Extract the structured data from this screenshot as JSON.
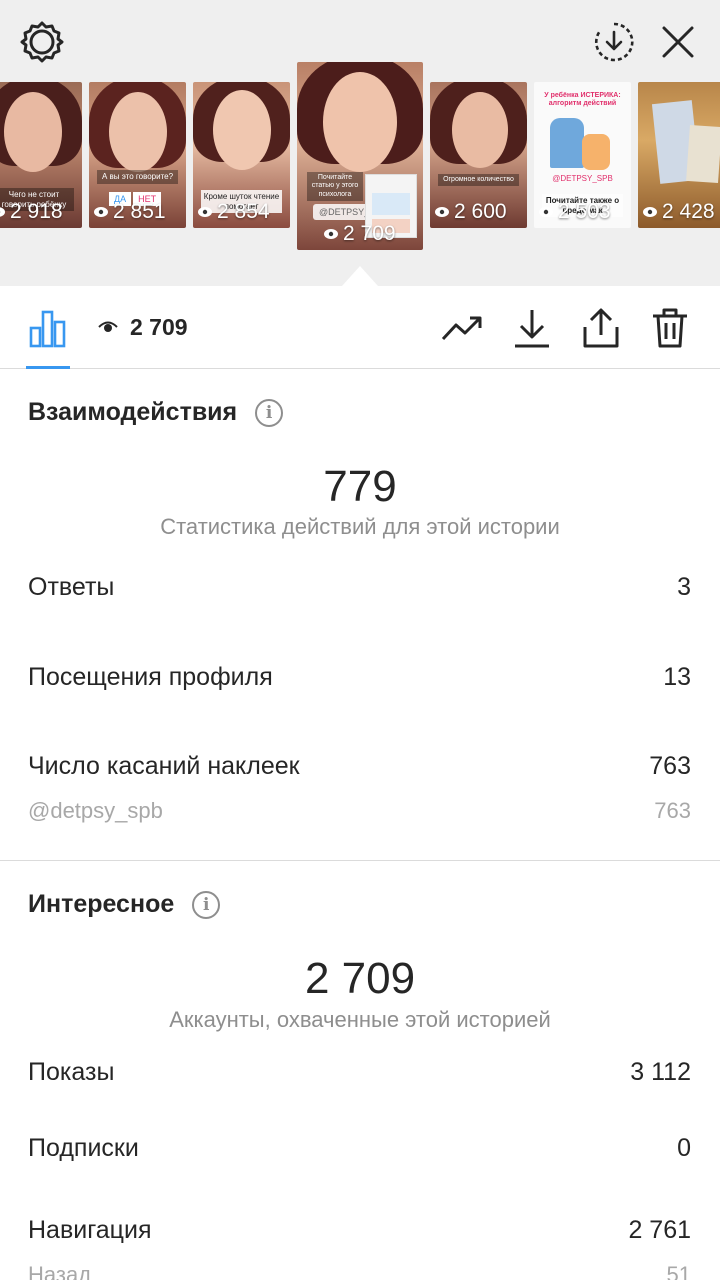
{
  "stories": [
    {
      "views": "2 918",
      "caption": "Чего не стоит говорить ребёнку"
    },
    {
      "views": "2 851",
      "caption": "А вы это говорите?",
      "poll": [
        "ДА",
        "НЕТ"
      ]
    },
    {
      "views": "2 854",
      "caption": "Кроме шуток чтение помогает"
    },
    {
      "views": "2 709",
      "caption": "Почитайте статью у этого психолога",
      "mention": "@DETPSY_SPB"
    },
    {
      "views": "2 600",
      "caption": "Огромное количество"
    },
    {
      "views": "2 503",
      "caption": "Почитайте также о вреде мак",
      "poster_title": "У ребёнка ИСТЕРИКА: алгоритм действий",
      "poster_tag": "@DETPSY_SPB"
    },
    {
      "views": "2 428",
      "caption": ""
    }
  ],
  "toolbar": {
    "views": "2 709",
    "icons": [
      "bar-chart-icon",
      "eye-icon",
      "trend-icon",
      "download-icon",
      "share-icon",
      "trash-icon"
    ],
    "accent": "#3897f0"
  },
  "interactions": {
    "title": "Взаимодействия",
    "total": "779",
    "subtitle": "Статистика действий для этой истории",
    "rows": [
      {
        "label": "Ответы",
        "value": "3"
      },
      {
        "label": "Посещения профиля",
        "value": "13"
      },
      {
        "label": "Число касаний наклеек",
        "value": "763"
      }
    ],
    "sub_row": {
      "label": "@detpsy_spb",
      "value": "763"
    }
  },
  "discovery": {
    "title": "Интересное",
    "total": "2 709",
    "subtitle": "Аккаунты, охваченные этой историей",
    "rows": [
      {
        "label": "Показы",
        "value": "3 112"
      },
      {
        "label": "Подписки",
        "value": "0"
      },
      {
        "label": "Навигация",
        "value": "2 761"
      }
    ],
    "sub_row": {
      "label": "Назад",
      "value": "51"
    }
  }
}
